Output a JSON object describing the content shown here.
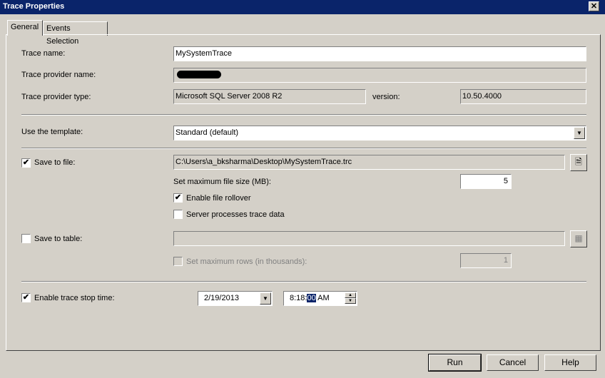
{
  "window": {
    "title": "Trace Properties",
    "close_glyph": "✕"
  },
  "tabs": [
    {
      "label": "General"
    },
    {
      "label": "Events Selection"
    }
  ],
  "general": {
    "trace_name_label": "Trace name:",
    "trace_name_value": "MySystemTrace",
    "provider_name_label": "Trace provider name:",
    "provider_type_label": "Trace provider type:",
    "provider_type_value": "Microsoft SQL Server 2008 R2",
    "version_label": "version:",
    "version_value": "10.50.4000",
    "template_label": "Use the template:",
    "template_value": "Standard (default)",
    "save_to_file_label": "Save to file:",
    "save_to_file_checked": true,
    "file_path": "C:\\Users\\a_bksharma\\Desktop\\MySystemTrace.trc",
    "max_file_size_label": "Set maximum file size (MB):",
    "max_file_size_value": "5",
    "enable_rollover_label": "Enable file rollover",
    "enable_rollover_checked": true,
    "server_processes_label": "Server processes trace data",
    "server_processes_checked": false,
    "save_to_table_label": "Save to table:",
    "save_to_table_checked": false,
    "max_rows_label": "Set maximum rows (in thousands):",
    "max_rows_value": "1",
    "stop_time_label": "Enable trace stop time:",
    "stop_time_checked": true,
    "stop_date": "2/19/2013",
    "stop_time_prefix": "8:18:",
    "stop_time_selected": "00",
    "stop_time_suffix": " AM"
  },
  "buttons": {
    "run": "Run",
    "cancel": "Cancel",
    "help": "Help"
  },
  "glyphs": {
    "check": "✔",
    "dropdown": "▼",
    "spin_up": "▲",
    "spin_down": "▼",
    "browse_file": "🗎",
    "browse_table": "▦"
  },
  "colors": {
    "titlebar": "#0a246a",
    "face": "#d4d0c8",
    "selection": "#0a246a"
  }
}
